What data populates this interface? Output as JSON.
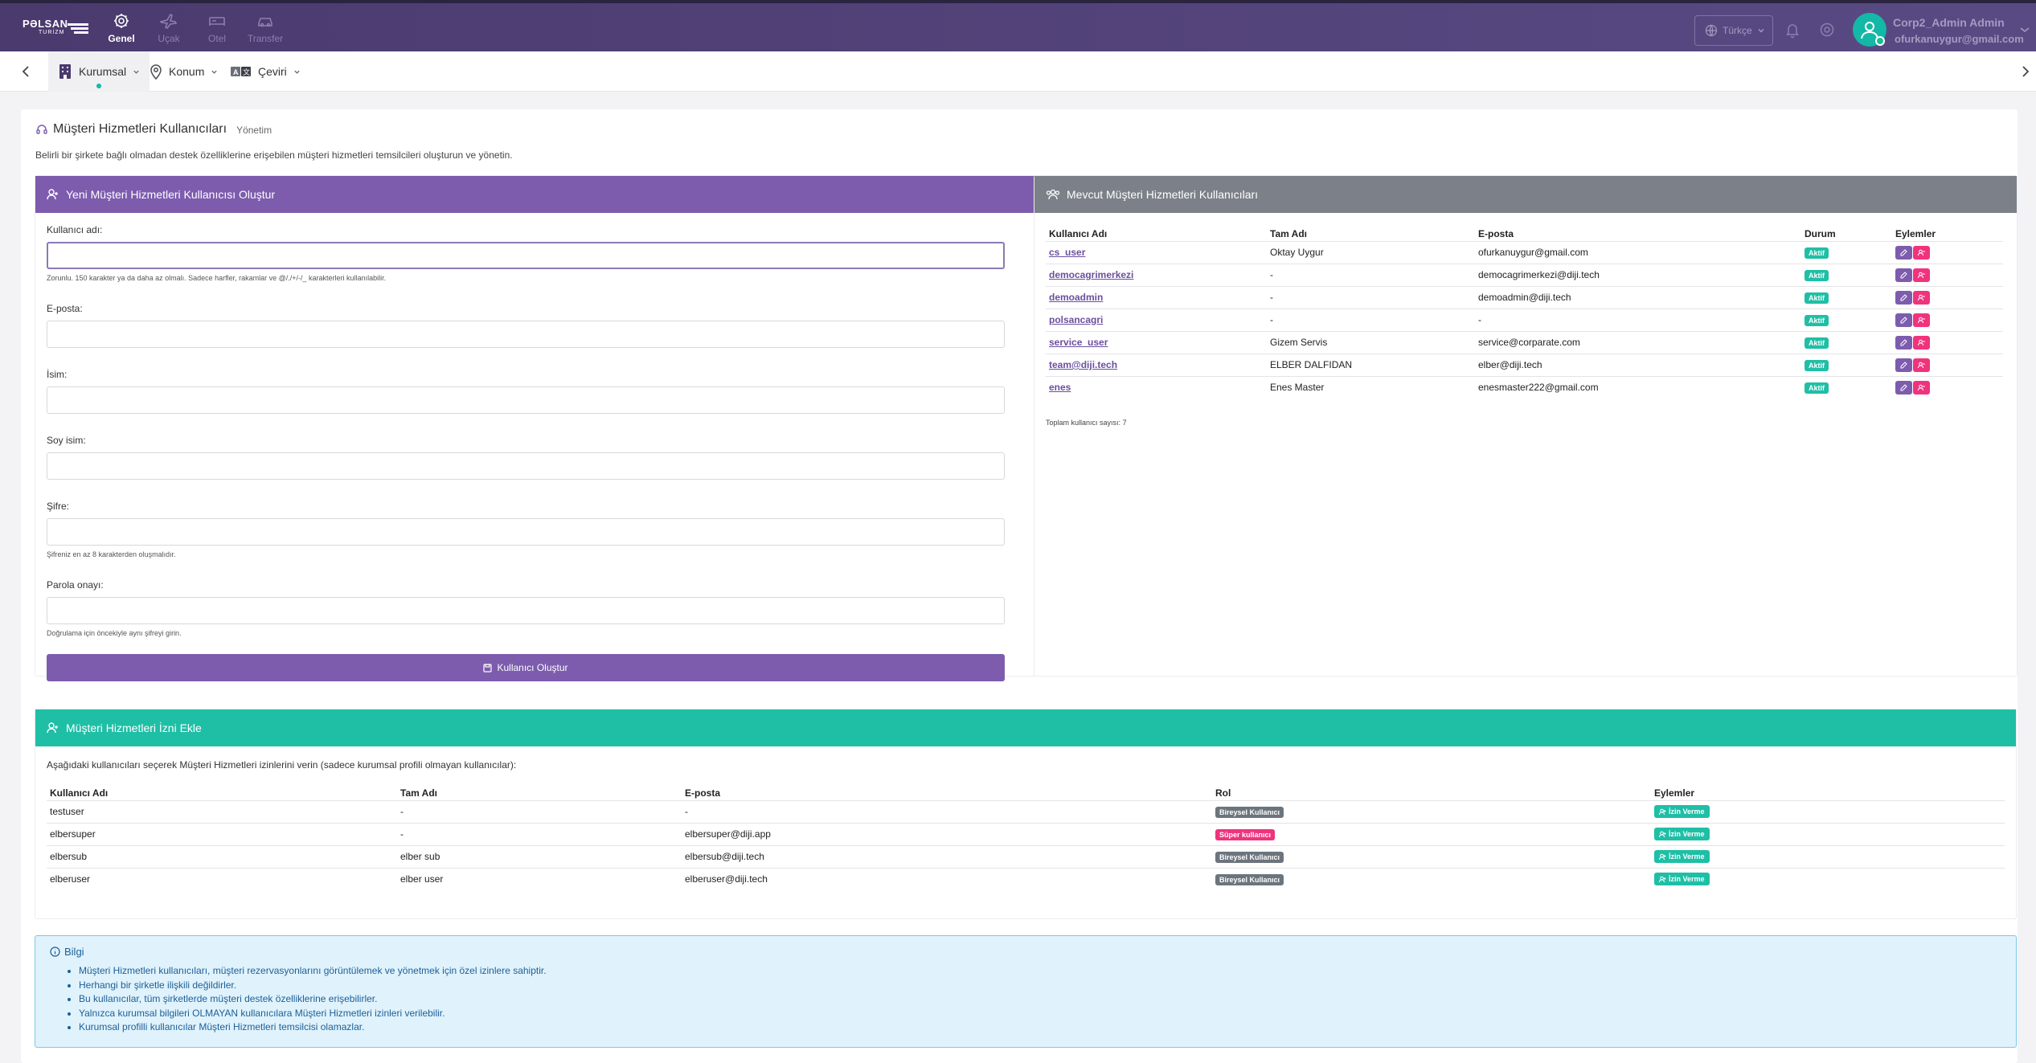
{
  "header": {
    "logo_top": "PƏLSAN",
    "logo_bottom": "TURİZM",
    "nav": [
      {
        "label": "Genel",
        "icon": "gear-icon"
      },
      {
        "label": "Uçak",
        "icon": "plane-icon"
      },
      {
        "label": "Otel",
        "icon": "bed-icon"
      },
      {
        "label": "Transfer",
        "icon": "car-icon"
      }
    ],
    "language": "Türkçe",
    "user_name": "Corp2_Admin Admin",
    "user_email": "ofurkanuygur@gmail.com"
  },
  "subnav": {
    "tabs": [
      {
        "label": "Kurumsal",
        "icon": "building-icon"
      },
      {
        "label": "Konum",
        "icon": "map-pin-icon"
      },
      {
        "label": "Çeviri",
        "icon": "translate-icon"
      }
    ]
  },
  "page": {
    "title": "Müşteri Hizmetleri Kullanıcıları",
    "subtitle": "Yönetim",
    "description": "Belirli bir şirkete bağlı olmadan destek özelliklerine erişebilen müşteri hizmetleri temsilcileri oluşturun ve yönetin."
  },
  "create_form": {
    "title": "Yeni Müşteri Hizmetleri Kullanıcısı Oluştur",
    "username_label": "Kullanıcı adı:",
    "username_help": "Zorunlu. 150 karakter ya da daha az olmalı. Sadece harfler, rakamlar ve @/./+/-/_ karakterleri kullanılabilir.",
    "email_label": "E-posta:",
    "first_name_label": "İsim:",
    "last_name_label": "Soy isim:",
    "password_label": "Şifre:",
    "password_help": "Şifreniz en az 8 karakterden oluşmalıdır.",
    "password_confirm_label": "Parola onayı:",
    "password_confirm_help": "Doğrulama için öncekiyle aynı şifreyi girin.",
    "submit_label": "Kullanıcı Oluştur"
  },
  "existing_users": {
    "title": "Mevcut Müşteri Hizmetleri Kullanıcıları",
    "columns": [
      "Kullanıcı Adı",
      "Tam Adı",
      "E-posta",
      "Durum",
      "Eylemler"
    ],
    "rows": [
      {
        "username": "cs_user",
        "full_name": "Oktay Uygur",
        "email": "ofurkanuygur@gmail.com",
        "status": "Aktif"
      },
      {
        "username": "democagrimerkezi",
        "full_name": "-",
        "email": "democagrimerkezi@diji.tech",
        "status": "Aktif"
      },
      {
        "username": "demoadmin",
        "full_name": "-",
        "email": "demoadmin@diji.tech",
        "status": "Aktif"
      },
      {
        "username": "polsancagri",
        "full_name": "-",
        "email": "-",
        "status": "Aktif"
      },
      {
        "username": "service_user",
        "full_name": "Gizem Servis",
        "email": "service@corparate.com",
        "status": "Aktif"
      },
      {
        "username": "team@diji.tech",
        "full_name": "ELBER DALFIDAN",
        "email": "elber@diji.tech",
        "status": "Aktif"
      },
      {
        "username": "enes",
        "full_name": "Enes Master",
        "email": "enesmaster222@gmail.com",
        "status": "Aktif"
      }
    ],
    "total_label": "Toplam kullanıcı sayısı:",
    "total_count": "7"
  },
  "permissions": {
    "title": "Müşteri Hizmetleri İzni Ekle",
    "description": "Aşağıdaki kullanıcıları seçerek Müşteri Hizmetleri izinlerini verin (sadece kurumsal profili olmayan kullanıcılar):",
    "columns": [
      "Kullanıcı Adı",
      "Tam Adı",
      "E-posta",
      "Rol",
      "Eylemler"
    ],
    "rows": [
      {
        "username": "testuser",
        "full_name": "-",
        "email": "-",
        "role": "Bireysel Kullanıcı",
        "role_color": "#6c757d",
        "action": "İzin Verme"
      },
      {
        "username": "elbersuper",
        "full_name": "-",
        "email": "elbersuper@diji.app",
        "role": "Süper kullanıcı",
        "role_color": "#f0337d",
        "action": "İzin Verme"
      },
      {
        "username": "elbersub",
        "full_name": "elber sub",
        "email": "elbersub@diji.tech",
        "role": "Bireysel Kullanıcı",
        "role_color": "#6c757d",
        "action": "İzin Verme"
      },
      {
        "username": "elberuser",
        "full_name": "elber user",
        "email": "elberuser@diji.tech",
        "role": "Bireysel Kullanıcı",
        "role_color": "#6c757d",
        "action": "İzin Verme"
      }
    ]
  },
  "info": {
    "title": "Bilgi",
    "items": [
      "Müşteri Hizmetleri kullanıcıları, müşteri rezervasyonlarını görüntülemek ve yönetmek için özel izinlere sahiptir.",
      "Herhangi bir şirketle ilişkili değildirler.",
      "Bu kullanıcılar, tüm şirketlerde müşteri destek özelliklerine erişebilirler.",
      "Yalnızca kurumsal bilgileri OLMAYAN kullanıcılara Müşteri Hizmetleri izinleri verilebilir.",
      "Kurumsal profilli kullanıcılar Müşteri Hizmetleri temsilcisi olamazlar."
    ]
  },
  "colors": {
    "header": "#4a3a6e",
    "primary": "#7d5cae",
    "grey_header": "#7c8189",
    "teal": "#1fbfa6",
    "pink": "#f0337d",
    "info_bg": "#e0f2fb"
  }
}
